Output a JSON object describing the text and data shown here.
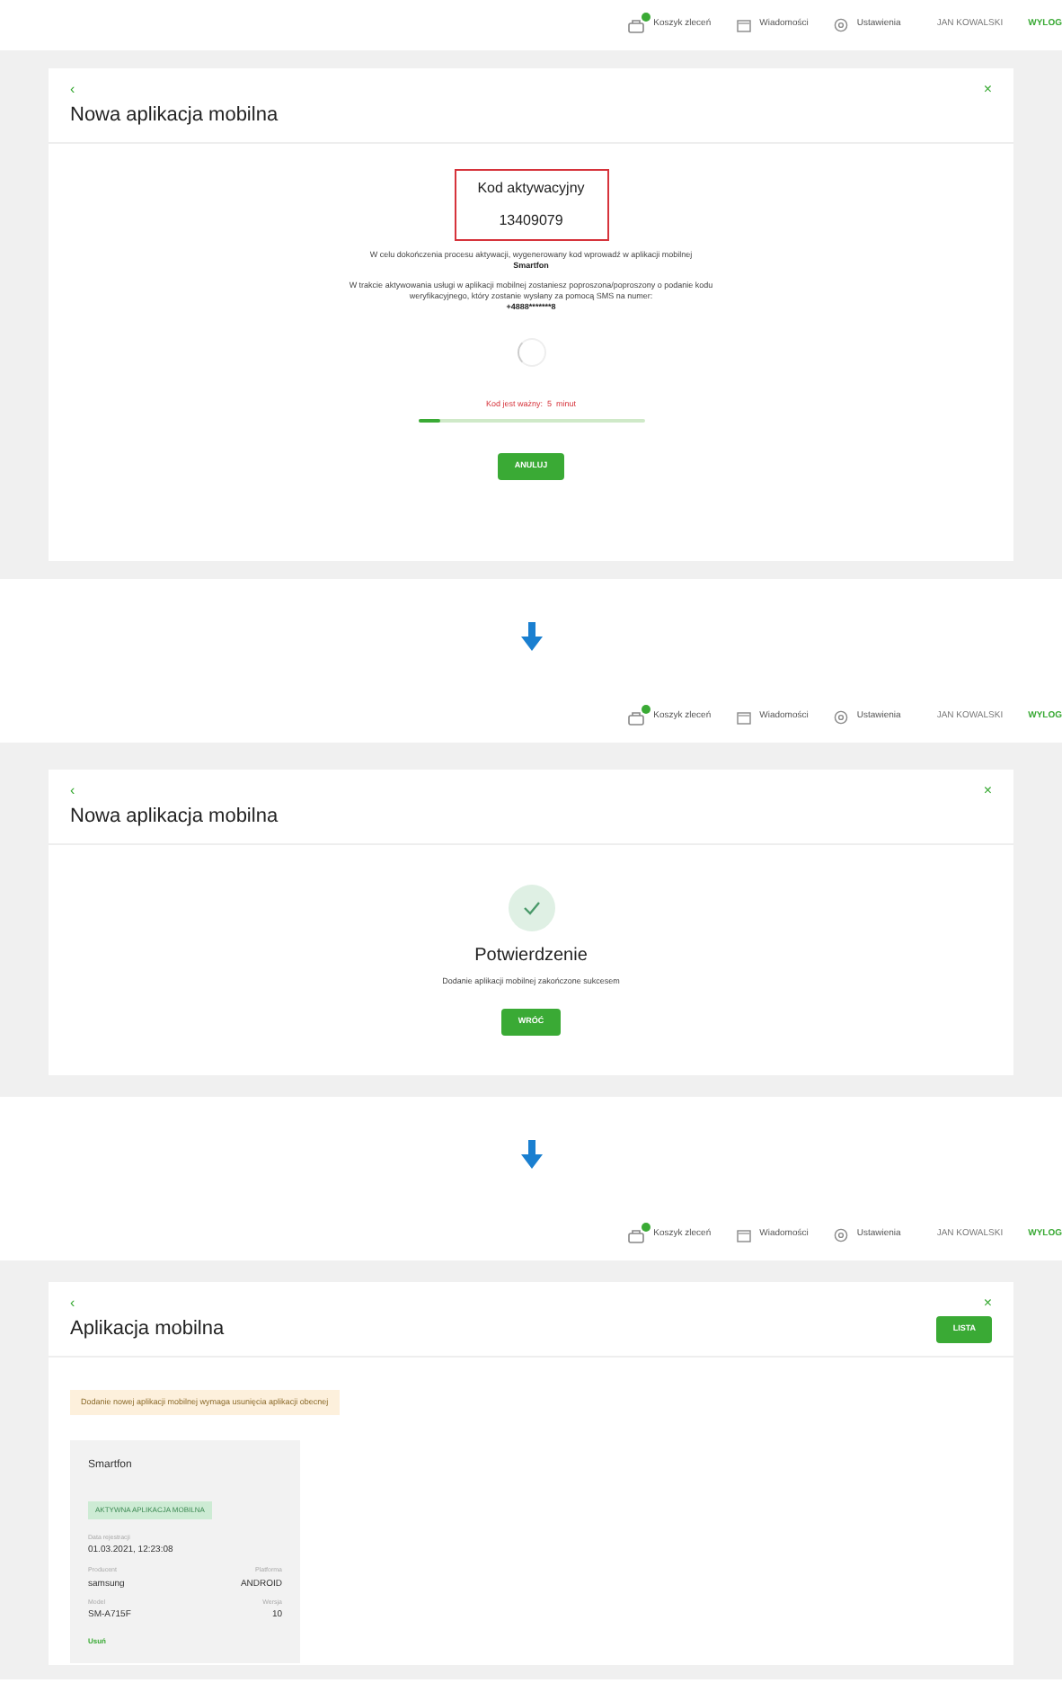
{
  "screens": [
    {
      "header": {
        "items": [
          {
            "kind": "cart",
            "label": "Koszyk zleceń",
            "badge": true
          },
          {
            "kind": "mail",
            "label": "Wiadomości"
          },
          {
            "kind": "gear",
            "label": "Ustawienia"
          },
          {
            "kind": "user",
            "label": "JAN KOWALSKI"
          },
          {
            "kind": "logout",
            "label": "WYLOG"
          }
        ]
      },
      "card": {
        "kind": "activation",
        "back": "‹",
        "close": "×",
        "title": "Nowa aplikacja mobilna",
        "code_label": "Kod aktywacyjny",
        "code": "13409079",
        "paragraphs": [
          {
            "text": "W celu dokończenia procesu aktywacji, wygenerowany kod wprowadź w aplikacji mobilnej",
            "strong": "Smartfon"
          },
          {
            "text": "W trakcie aktywowania usługi w aplikacji mobilnej zostaniesz poproszona/poproszony o podanie kodu weryfikacyjnego, który zostanie wysłany za pomocą SMS na numer:",
            "strong": "+4888*******8"
          }
        ],
        "validity": "Kod jest ważny:  5  minut",
        "progress": {
          "level": 0.1
        },
        "button": "ANULUJ"
      }
    },
    {
      "header": {
        "items": [
          {
            "kind": "cart",
            "label": "Koszyk zleceń",
            "badge": true
          },
          {
            "kind": "mail",
            "label": "Wiadomości"
          },
          {
            "kind": "gear",
            "label": "Ustawienia"
          },
          {
            "kind": "user",
            "label": "JAN KOWALSKI"
          },
          {
            "kind": "logout",
            "label": "WYLOG"
          }
        ]
      },
      "card": {
        "kind": "confirmation",
        "back": "‹",
        "close": "×",
        "title": "Nowa aplikacja mobilna",
        "heading": "Potwierdzenie",
        "message": "Dodanie aplikacji mobilnej zakończone sukcesem",
        "button": "WRÓĆ"
      }
    },
    {
      "header": {
        "items": [
          {
            "kind": "cart",
            "label": "Koszyk zleceń",
            "badge": true
          },
          {
            "kind": "mail",
            "label": "Wiadomości"
          },
          {
            "kind": "gear",
            "label": "Ustawienia"
          },
          {
            "kind": "user",
            "label": "JAN KOWALSKI"
          },
          {
            "kind": "logout",
            "label": "WYLOG"
          }
        ]
      },
      "card": {
        "kind": "list",
        "back": "‹",
        "close": "×",
        "title": "Aplikacja mobilna",
        "button": "LISTA",
        "alert": "Dodanie nowej aplikacji mobilnej wymaga usunięcia aplikacji obecnej",
        "device": {
          "name": "Smartfon",
          "status": "AKTYWNA APLIKACJA MOBILNA",
          "date_label": "Data rejestracji",
          "date": "01.03.2021, 12:23:08",
          "fields": [
            {
              "label": "Producent",
              "value": "samsung"
            },
            {
              "label": "Platforma",
              "value": "ANDROID"
            },
            {
              "label": "Model",
              "value": "SM-A715F"
            },
            {
              "label": "Wersja",
              "value": "10"
            }
          ],
          "remove": "Usuń"
        }
      }
    }
  ]
}
